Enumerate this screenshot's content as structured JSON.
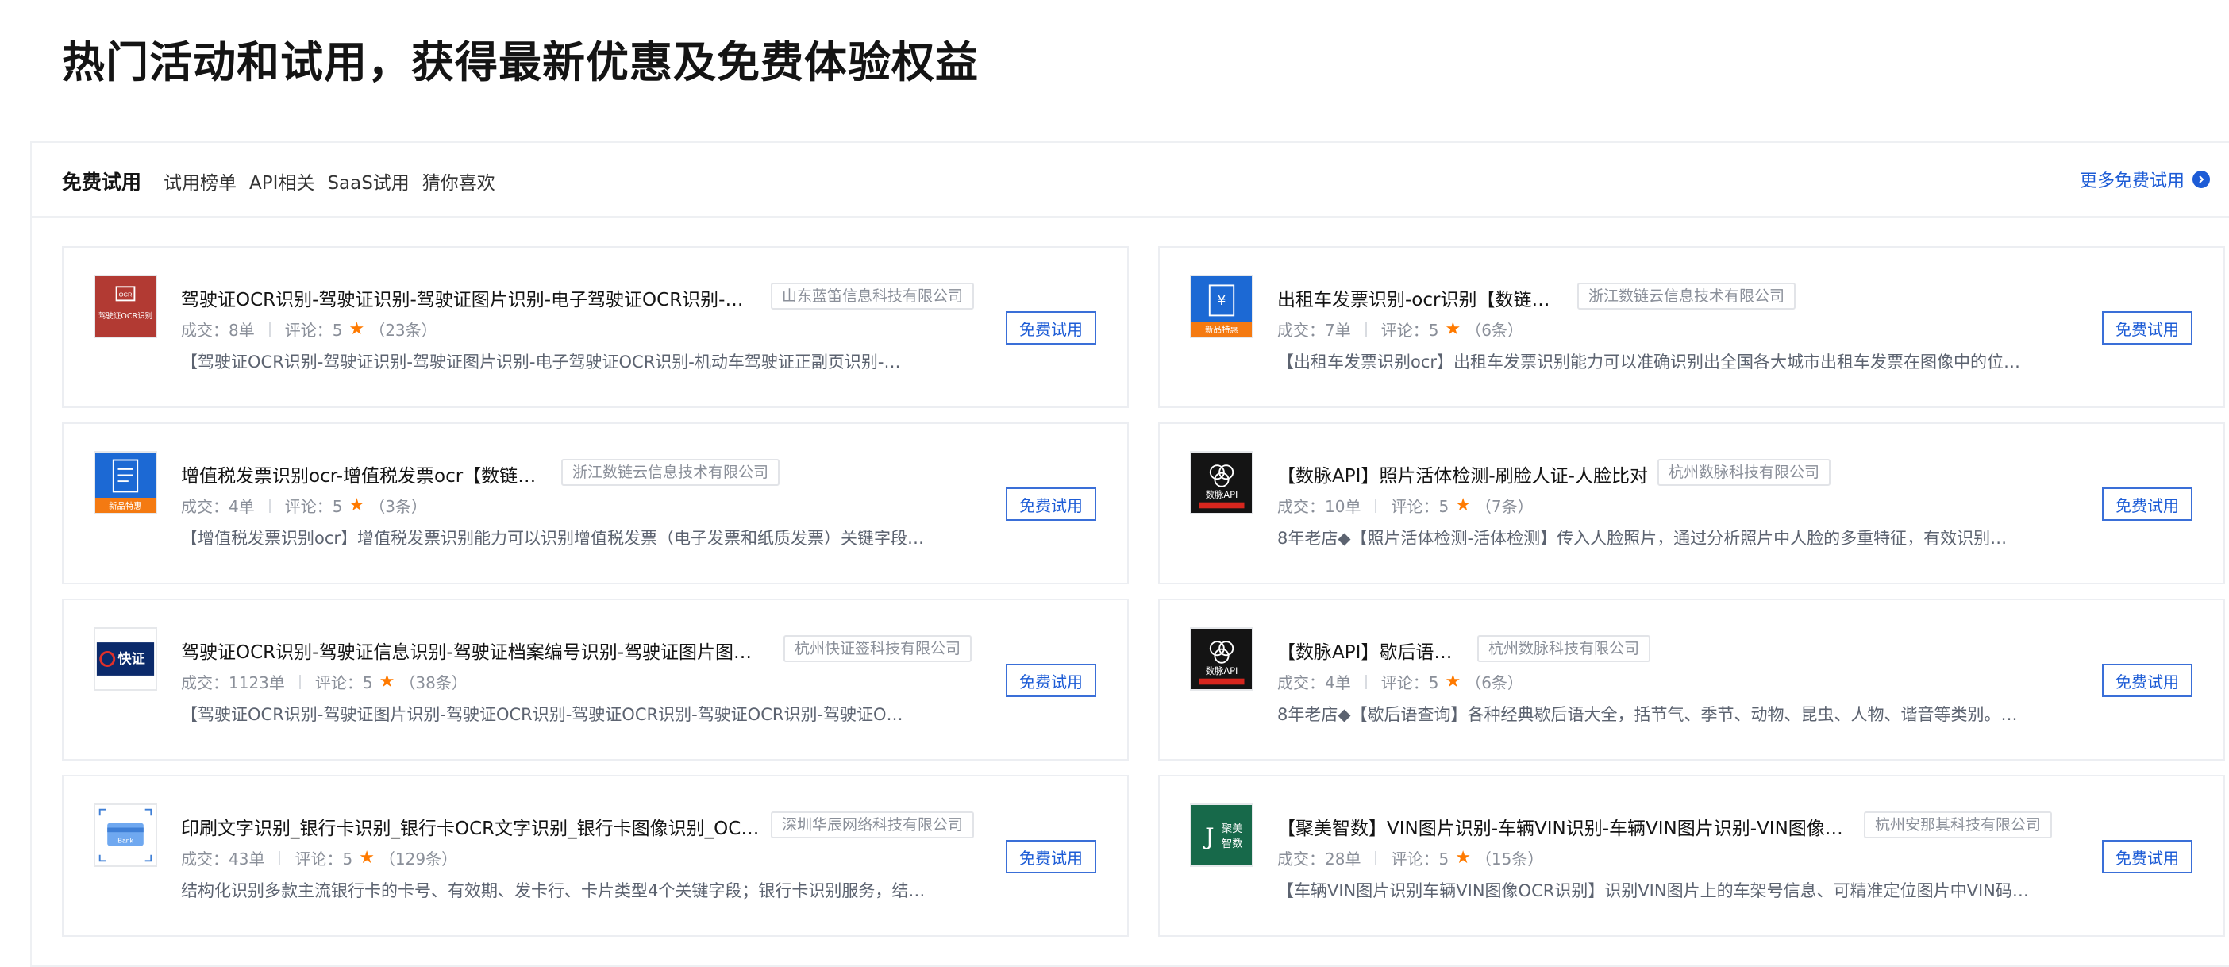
{
  "page": {
    "title": "热门活动和试用，获得最新优惠及免费体验权益"
  },
  "header": {
    "section_title": "免费试用",
    "tabs": [
      "试用榜单",
      "API相关",
      "SaaS试用",
      "猜你喜欢"
    ],
    "more_link": "更多免费试用"
  },
  "cards": [
    {
      "title": "驾驶证OCR识别-驾驶证识别-驾驶证图片识别-电子驾驶证OCR识别-…",
      "company": "山东蓝笛信息科技有限公司",
      "deals": "成交：8单",
      "reviews": "评论：5",
      "review_count": "（23条）",
      "desc": "【驾驶证OCR识别-驾驶证识别-驾驶证图片识别-电子驾驶证OCR识别-机动车驾驶证正副页识别-…",
      "button": "免费试用",
      "thumb_text": "驾驶证OCR识别",
      "icon": "driver-license-ocr-icon"
    },
    {
      "title": "出租车发票识别-ocr识别【数链云】",
      "company": "浙江数链云信息技术有限公司",
      "deals": "成交：7单",
      "reviews": "评论：5",
      "review_count": "（6条）",
      "desc": "【出租车发票识别ocr】出租车发票识别能力可以准确识别出全国各大城市出租车发票在图像中的位…",
      "button": "免费试用",
      "thumb_text": "新品特惠",
      "icon": "taxi-invoice-icon"
    },
    {
      "title": "增值税发票识别ocr-增值税发票ocr【数链云】",
      "company": "浙江数链云信息技术有限公司",
      "deals": "成交：4单",
      "reviews": "评论：5",
      "review_count": "（3条）",
      "desc": "【增值税发票识别ocr】增值税发票识别能力可以识别增值税发票（电子发票和纸质发票）关键字段…",
      "button": "免费试用",
      "thumb_text": "新品特惠",
      "icon": "vat-invoice-icon"
    },
    {
      "title": "【数脉API】照片活体检测-刷脸人证-人脸比对",
      "company": "杭州数脉科技有限公司",
      "deals": "成交：10单",
      "reviews": "评论：5",
      "review_count": "（7条）",
      "desc": "8年老店◆【照片活体检测-活体检测】传入人脸照片，通过分析照片中人脸的多重特征，有效识别…",
      "button": "免费试用",
      "thumb_text": "数脉API",
      "icon": "shumai-api-logo-icon"
    },
    {
      "title": "驾驶证OCR识别-驾驶证信息识别-驾驶证档案编号识别-驾驶证图片图像…",
      "company": "杭州快证签科技有限公司",
      "deals": "成交：1123单",
      "reviews": "评论：5",
      "review_count": "（38条）",
      "desc": "【驾驶证OCR识别-驾驶证图片识别-驾驶证OCR识别-驾驶证OCR识别-驾驶证OCR识别-驾驶证O…",
      "button": "免费试用",
      "thumb_text": "快证",
      "icon": "kuaizheng-logo-icon"
    },
    {
      "title": "【数脉API】歇后语查询",
      "company": "杭州数脉科技有限公司",
      "deals": "成交：4单",
      "reviews": "评论：5",
      "review_count": "（6条）",
      "desc": "8年老店◆【歇后语查询】各种经典歇后语大全，括节气、季节、动物、昆虫、人物、谐音等类别。…",
      "button": "免费试用",
      "thumb_text": "数脉API",
      "icon": "shumai-api-logo-icon"
    },
    {
      "title": "印刷文字识别_银行卡识别_银行卡OCR文字识别_银行卡图像识别_OCR…",
      "company": "深圳华辰网络科技有限公司",
      "deals": "成交：43单",
      "reviews": "评论：5",
      "review_count": "（129条）",
      "desc": "结构化识别多款主流银行卡的卡号、有效期、发卡行、卡片类型4个关键字段；银行卡识别服务，结…",
      "button": "免费试用",
      "thumb_text": "Bank",
      "icon": "bank-card-icon"
    },
    {
      "title": "【聚美智数】VIN图片识别-车辆VIN识别-车辆VIN图片识别-VIN图像OC…",
      "company": "杭州安那其科技有限公司",
      "deals": "成交：28单",
      "reviews": "评论：5",
      "review_count": "（15条）",
      "desc": "【车辆VIN图片识别车辆VIN图像OCR识别】识别VIN图片上的车架号信息、可精准定位图片中VIN码…",
      "button": "免费试用",
      "thumb_text": "聚美智数",
      "icon": "jumei-zhishu-logo-icon"
    }
  ],
  "colors": {
    "accent": "#1d5cd6",
    "star": "#ff7a00",
    "thumb_red": "#b23a33",
    "thumb_blue": "#1c69d4",
    "thumb_orange": "#f47a12",
    "thumb_navy": "#0b2a6b",
    "thumb_green": "#17694a"
  }
}
